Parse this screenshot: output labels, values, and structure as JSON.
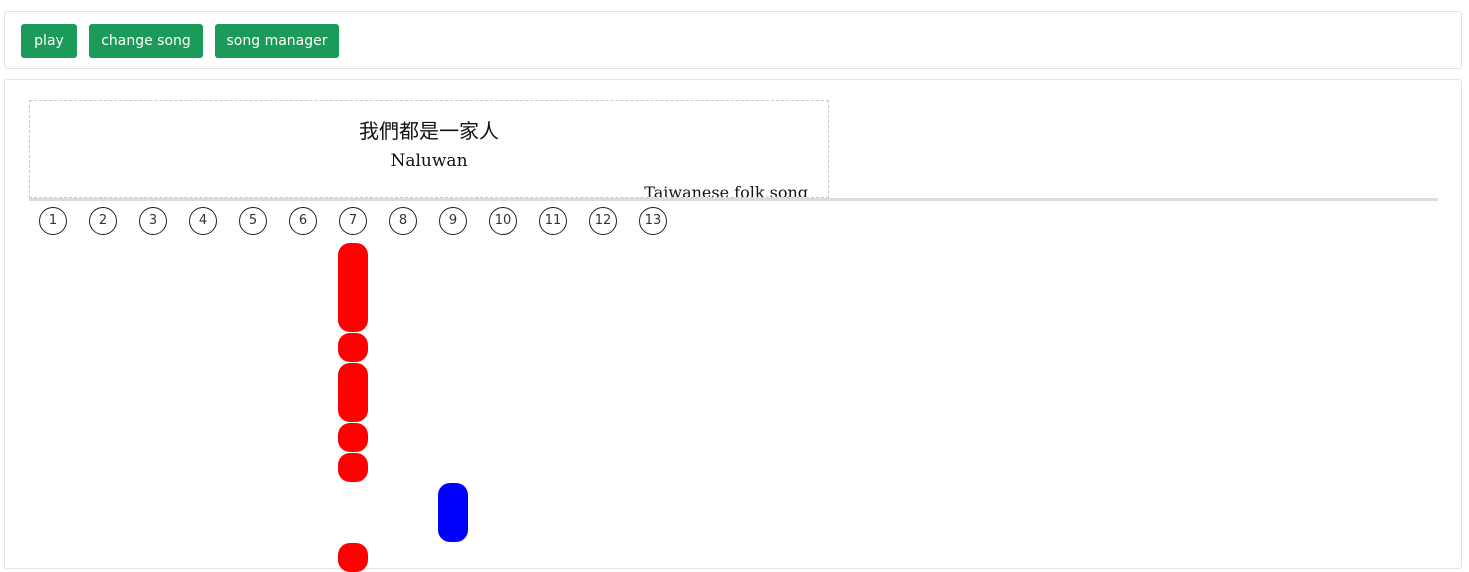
{
  "toolbar": {
    "play_label": "play",
    "change_song_label": "change song",
    "song_manager_label": "song manager"
  },
  "song": {
    "title": "我們都是一家人",
    "subtitle": "Naluwan",
    "credit": "Taiwanese folk song"
  },
  "holes": [
    "1",
    "2",
    "3",
    "4",
    "5",
    "6",
    "7",
    "8",
    "9",
    "10",
    "11",
    "12",
    "13"
  ],
  "notes": [
    {
      "hole": 7,
      "color": "#ff0000",
      "start": 0,
      "length": 3
    },
    {
      "hole": 7,
      "color": "#ff0000",
      "start": 3,
      "length": 1
    },
    {
      "hole": 7,
      "color": "#ff0000",
      "start": 4,
      "length": 2
    },
    {
      "hole": 7,
      "color": "#ff0000",
      "start": 6,
      "length": 1
    },
    {
      "hole": 7,
      "color": "#ff0000",
      "start": 7,
      "length": 1
    },
    {
      "hole": 9,
      "color": "#0000ff",
      "start": 8,
      "length": 2
    },
    {
      "hole": 7,
      "color": "#ff0000",
      "start": 10,
      "length": 1
    }
  ],
  "colors": {
    "button": "#1a9b59",
    "note_red": "#ff0000",
    "note_blue": "#0000ff"
  }
}
